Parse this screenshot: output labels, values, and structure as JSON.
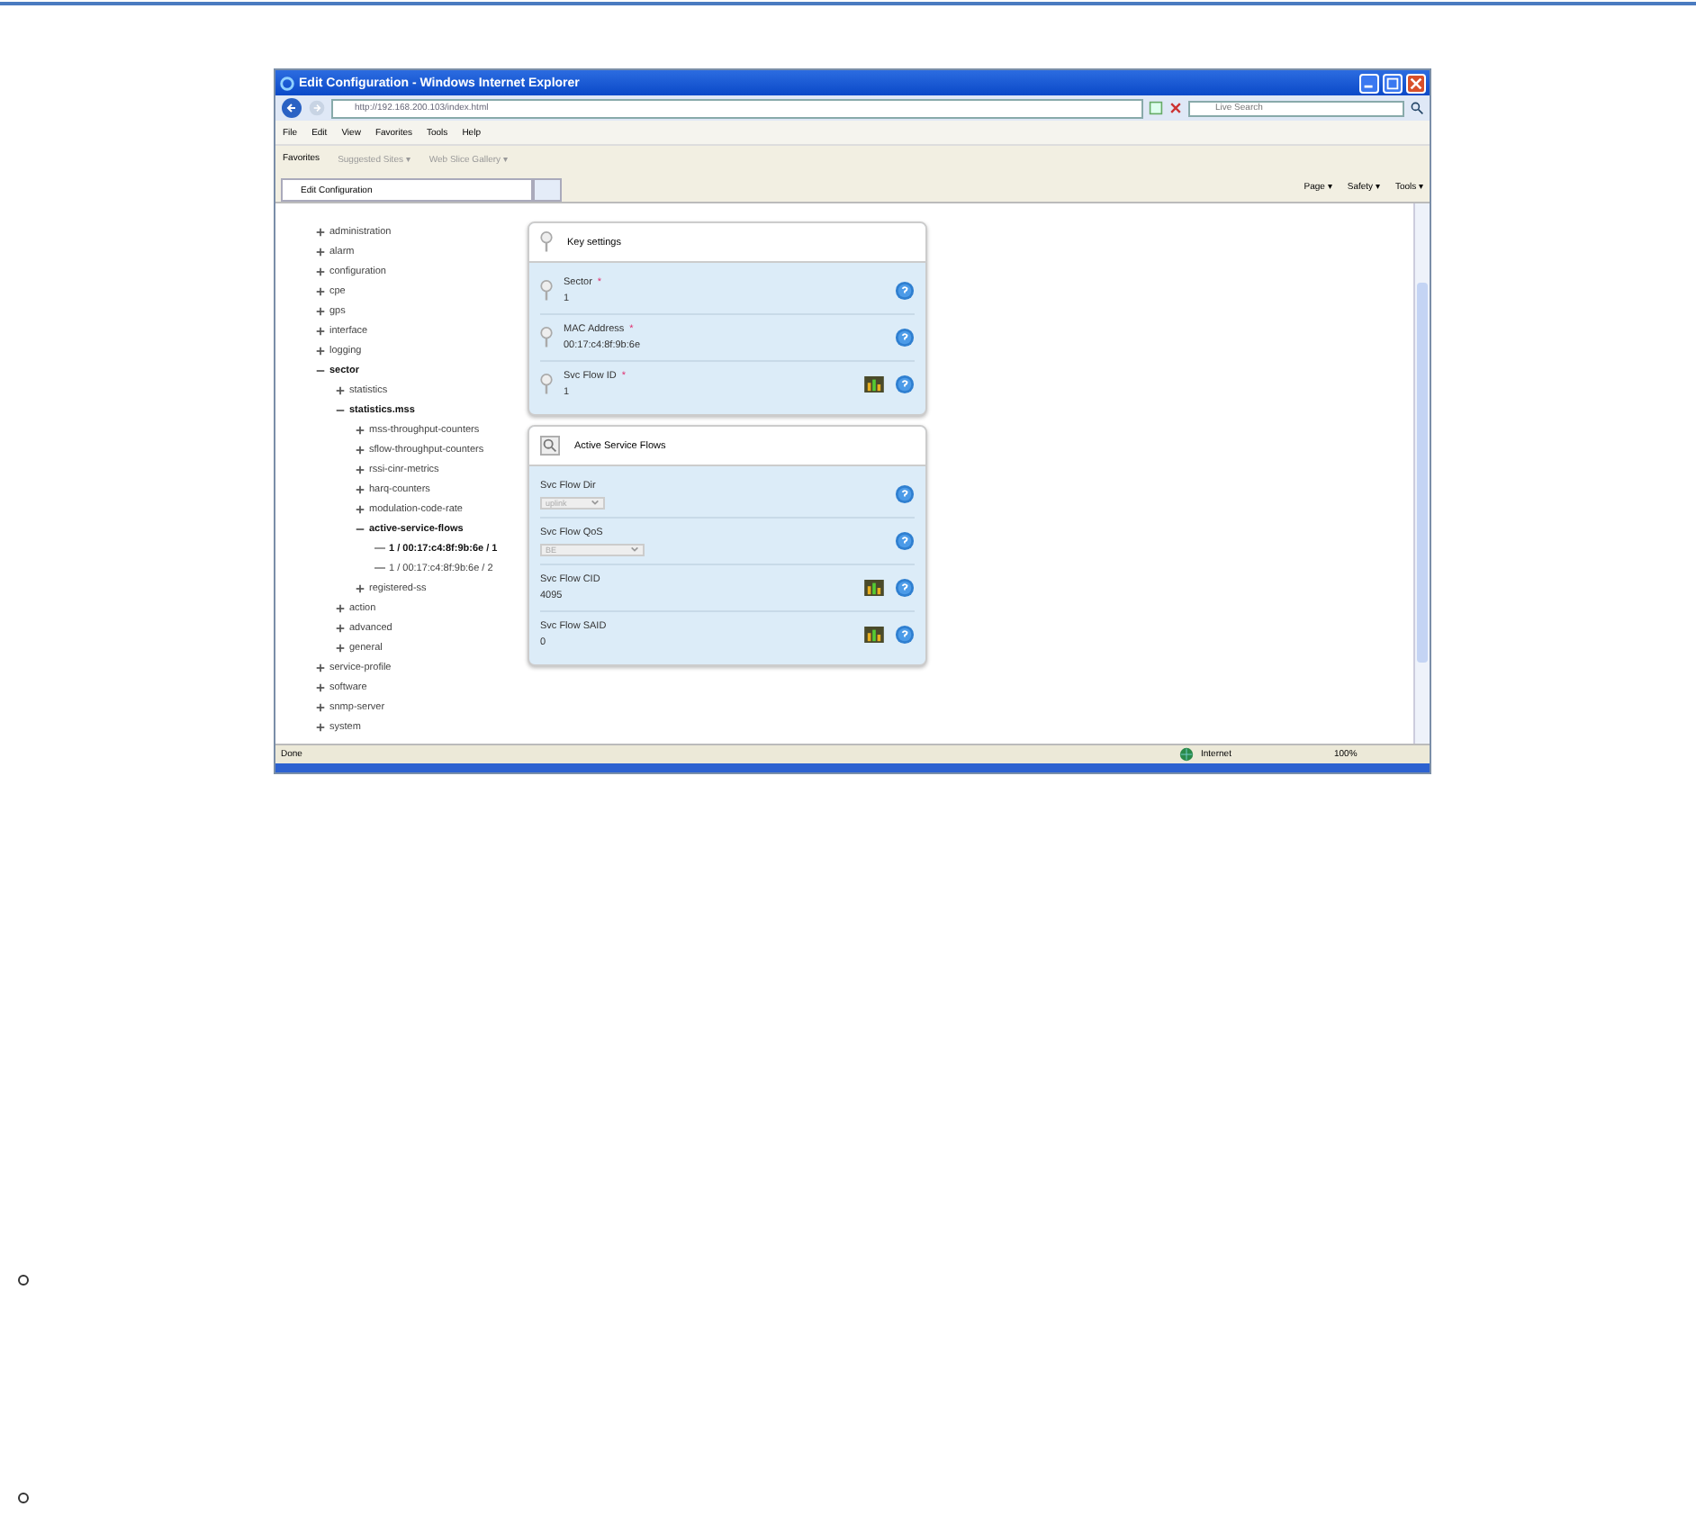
{
  "window": {
    "title": "Edit Configuration - Windows Internet Explorer"
  },
  "address_bar": {
    "value": "http://192.168.200.103/index.html"
  },
  "search": {
    "placeholder": "Live Search"
  },
  "menu": [
    "File",
    "Edit",
    "View",
    "Favorites",
    "Tools",
    "Help"
  ],
  "favorites_bar": {
    "favorites": "Favorites",
    "items": [
      "Suggested Sites ▾",
      "Web Slice Gallery ▾"
    ]
  },
  "tabs": [
    {
      "label": "Edit Configuration",
      "selected": true
    }
  ],
  "command_bar": [
    "Page ▾",
    "Safety ▾",
    "Tools ▾"
  ],
  "tree": [
    {
      "label": "administration",
      "expanded": false
    },
    {
      "label": "alarm",
      "expanded": false
    },
    {
      "label": "configuration",
      "expanded": false
    },
    {
      "label": "cpe",
      "expanded": false
    },
    {
      "label": "gps",
      "expanded": false
    },
    {
      "label": "interface",
      "expanded": false
    },
    {
      "label": "logging",
      "expanded": false
    },
    {
      "label": "sector",
      "expanded": true,
      "children": [
        {
          "label": "statistics",
          "expanded": false
        },
        {
          "label": "statistics.mss",
          "expanded": true,
          "children": [
            {
              "label": "mss-throughput-counters",
              "expanded": false
            },
            {
              "label": "sflow-throughput-counters",
              "expanded": false
            },
            {
              "label": "rssi-cinr-metrics",
              "expanded": false
            },
            {
              "label": "harq-counters",
              "expanded": false
            },
            {
              "label": "modulation-code-rate",
              "expanded": false
            },
            {
              "label": "active-service-flows",
              "expanded": true,
              "children": [
                {
                  "label": "1 / 00:17:c4:8f:9b:6e / 1",
                  "kind": "leaf",
                  "selected": true
                },
                {
                  "label": "1 / 00:17:c4:8f:9b:6e / 2",
                  "kind": "leaf",
                  "selected": false
                }
              ]
            },
            {
              "label": "registered-ss",
              "expanded": false
            }
          ]
        },
        {
          "label": "action",
          "expanded": false
        },
        {
          "label": "advanced",
          "expanded": false
        },
        {
          "label": "general",
          "expanded": false
        }
      ]
    },
    {
      "label": "service-profile",
      "expanded": false
    },
    {
      "label": "software",
      "expanded": false
    },
    {
      "label": "snmp-server",
      "expanded": false
    },
    {
      "label": "system",
      "expanded": false
    }
  ],
  "panels": [
    {
      "title": "Key settings",
      "fields": [
        {
          "kind": "text",
          "label": "Sector",
          "required_mark": "*",
          "value": "1"
        },
        {
          "kind": "text",
          "label": "MAC Address",
          "required_mark": "*",
          "value": "00:17:c4:8f:9b:6e"
        },
        {
          "kind": "chart",
          "label": "Svc Flow ID",
          "required_mark": "*",
          "value": "1"
        }
      ]
    },
    {
      "title": "Active Service Flows",
      "fields": [
        {
          "kind": "select",
          "label": "Svc Flow Dir",
          "value": "uplink"
        },
        {
          "kind": "select",
          "label": "Svc Flow QoS",
          "value": "BE"
        },
        {
          "kind": "chart",
          "label": "Svc Flow CID",
          "value": "4095"
        },
        {
          "kind": "chart",
          "label": "Svc Flow SAID",
          "value": "0"
        }
      ]
    }
  ],
  "status_bar": {
    "status": "Done",
    "zone": "Internet",
    "zoom": "100%"
  }
}
